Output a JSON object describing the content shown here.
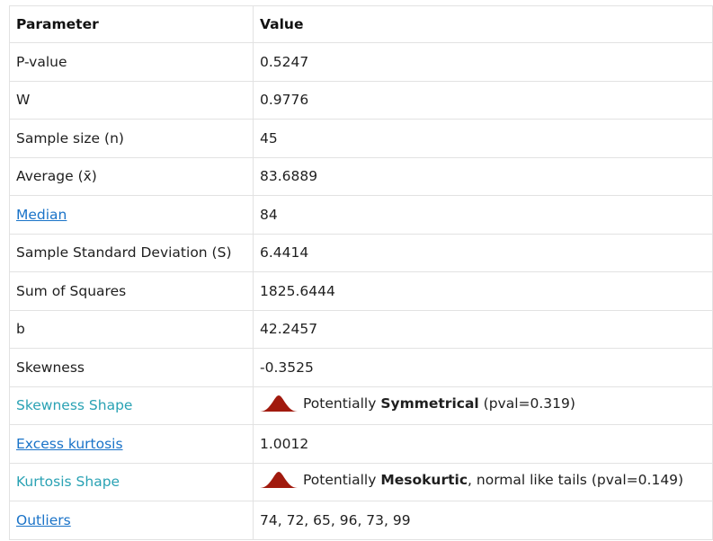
{
  "header": {
    "parameter": "Parameter",
    "value": "Value"
  },
  "rows": [
    {
      "label": "P-value",
      "value": "0.5247",
      "style": "plain"
    },
    {
      "label": "W",
      "value": "0.9776",
      "style": "plain"
    },
    {
      "label": "Sample size (n)",
      "value": "45",
      "style": "plain"
    },
    {
      "label": "Average (x̄)",
      "value": "83.6889",
      "style": "plain"
    },
    {
      "label": "Median",
      "value": "84",
      "style": "link"
    },
    {
      "label": "Sample Standard Deviation (S)",
      "value": "6.4414",
      "style": "plain"
    },
    {
      "label": "Sum of Squares",
      "value": "1825.6444",
      "style": "plain"
    },
    {
      "label": "b",
      "value": "42.2457",
      "style": "plain"
    },
    {
      "label": "Skewness",
      "value": "-0.3525",
      "style": "plain"
    }
  ],
  "skewness_shape": {
    "label": "Skewness Shape",
    "prefix": "Potentially ",
    "bold": "Symmetrical",
    "suffix": " (pval=0.319)",
    "icon": "bell-curve-icon",
    "icon_color": "#a11a0e"
  },
  "excess_kurtosis": {
    "label": "Excess kurtosis",
    "value": "1.0012"
  },
  "kurtosis_shape": {
    "label": "Kurtosis Shape",
    "prefix": "Potentially ",
    "bold": "Mesokurtic",
    "suffix": ", normal like tails (pval=0.149)",
    "icon": "bell-curve-icon",
    "icon_color": "#a11a0e"
  },
  "outliers": {
    "label": "Outliers",
    "value": "74, 72, 65, 96, 73, 99"
  },
  "colors": {
    "link": "#1a73c8",
    "teal_label": "#2aa2b4",
    "border": "#e2e2e2"
  }
}
